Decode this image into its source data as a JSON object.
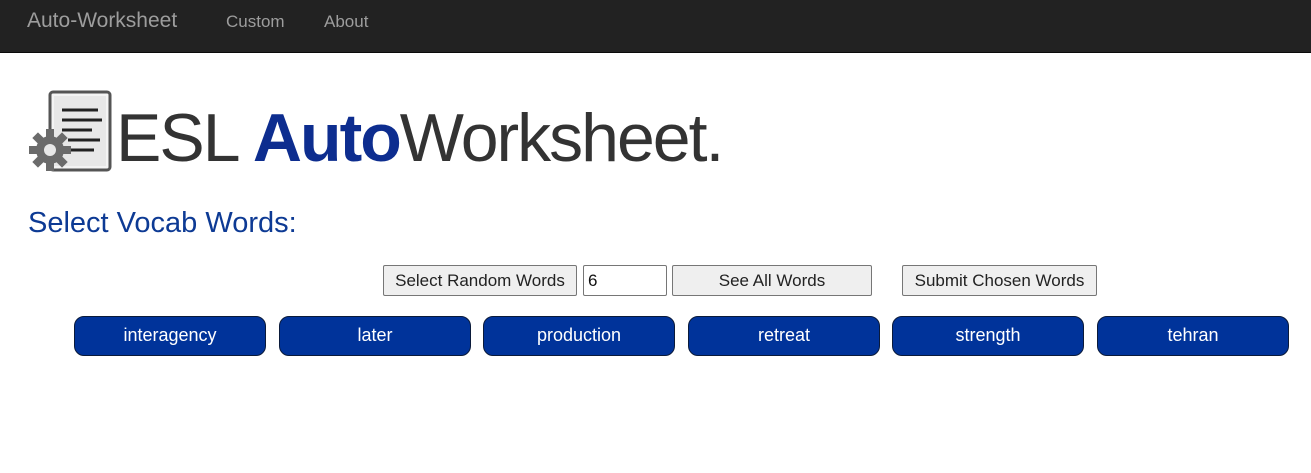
{
  "navbar": {
    "brand": "Auto-Worksheet",
    "links": [
      "Custom",
      "About"
    ]
  },
  "logo": {
    "part1": "ESL",
    "part2": "Auto",
    "part3": "Worksheet."
  },
  "heading": "Select Vocab Words:",
  "controls": {
    "random_button": "Select Random Words",
    "count_value": "6",
    "see_all_button": "See All Words",
    "submit_button": "Submit Chosen Words"
  },
  "words": [
    "interagency",
    "later",
    "production",
    "retreat",
    "strength",
    "tehran"
  ],
  "colors": {
    "navbar_bg": "#222222",
    "nav_text": "#9d9d9d",
    "accent_blue": "#00339a",
    "heading_blue": "#0d3a94"
  }
}
